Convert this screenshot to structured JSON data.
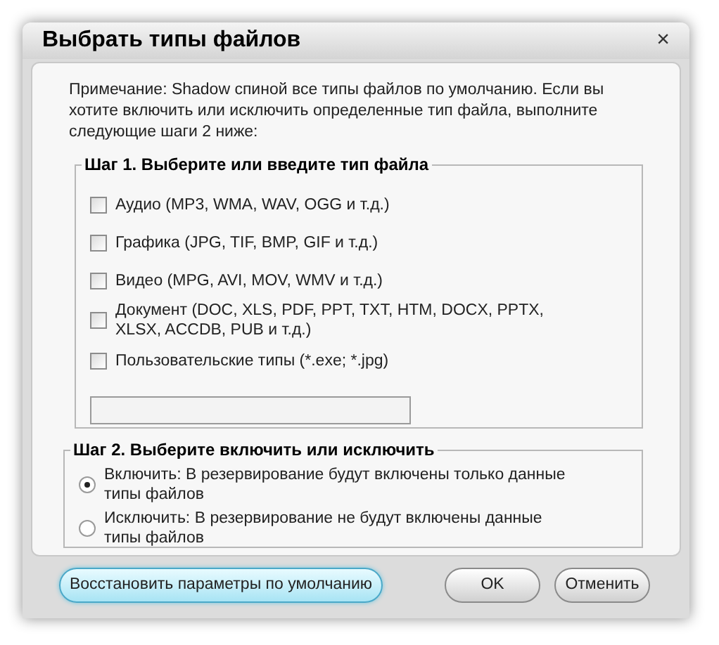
{
  "window": {
    "title": "Выбрать типы файлов",
    "close": "×"
  },
  "note": "Примечание: Shadow спиной все типы файлов по умолчанию. Если вы хотите включить или исключить определенные тип файла, выполните следующие шаги 2 ниже:",
  "step1": {
    "title": "Шаг 1. Выберите или введите тип файла",
    "options": [
      {
        "label": "Аудио (MP3, WMA, WAV, OGG и т.д.)",
        "checked": false
      },
      {
        "label": "Графика (JPG, TIF, BMP, GIF и т.д.)",
        "checked": false
      },
      {
        "label": "Видео (MPG, AVI, MOV, WMV и т.д.)",
        "checked": false
      },
      {
        "label": "Документ (DOC, XLS, PDF, PPT, TXT, HTM, DOCX, PPTX, XLSX, ACCDB, PUB и т.д.)",
        "checked": false
      },
      {
        "label": "Пользовательские типы (*.exe; *.jpg)",
        "checked": false
      }
    ]
  },
  "step2": {
    "title": "Шаг 2. Выберите включить или исключить",
    "options": [
      {
        "label": "Включить: В резервирование будут включены только данные типы файлов",
        "selected": true
      },
      {
        "label": "Исключить: В резервирование не будут включены данные типы файлов",
        "selected": false
      }
    ]
  },
  "buttons": [
    {
      "label": "Восстановить параметры по умолчанию",
      "kind": "accent"
    },
    {
      "label": "OK",
      "kind": "plain"
    },
    {
      "label": "Отменить",
      "kind": "plain"
    }
  ]
}
